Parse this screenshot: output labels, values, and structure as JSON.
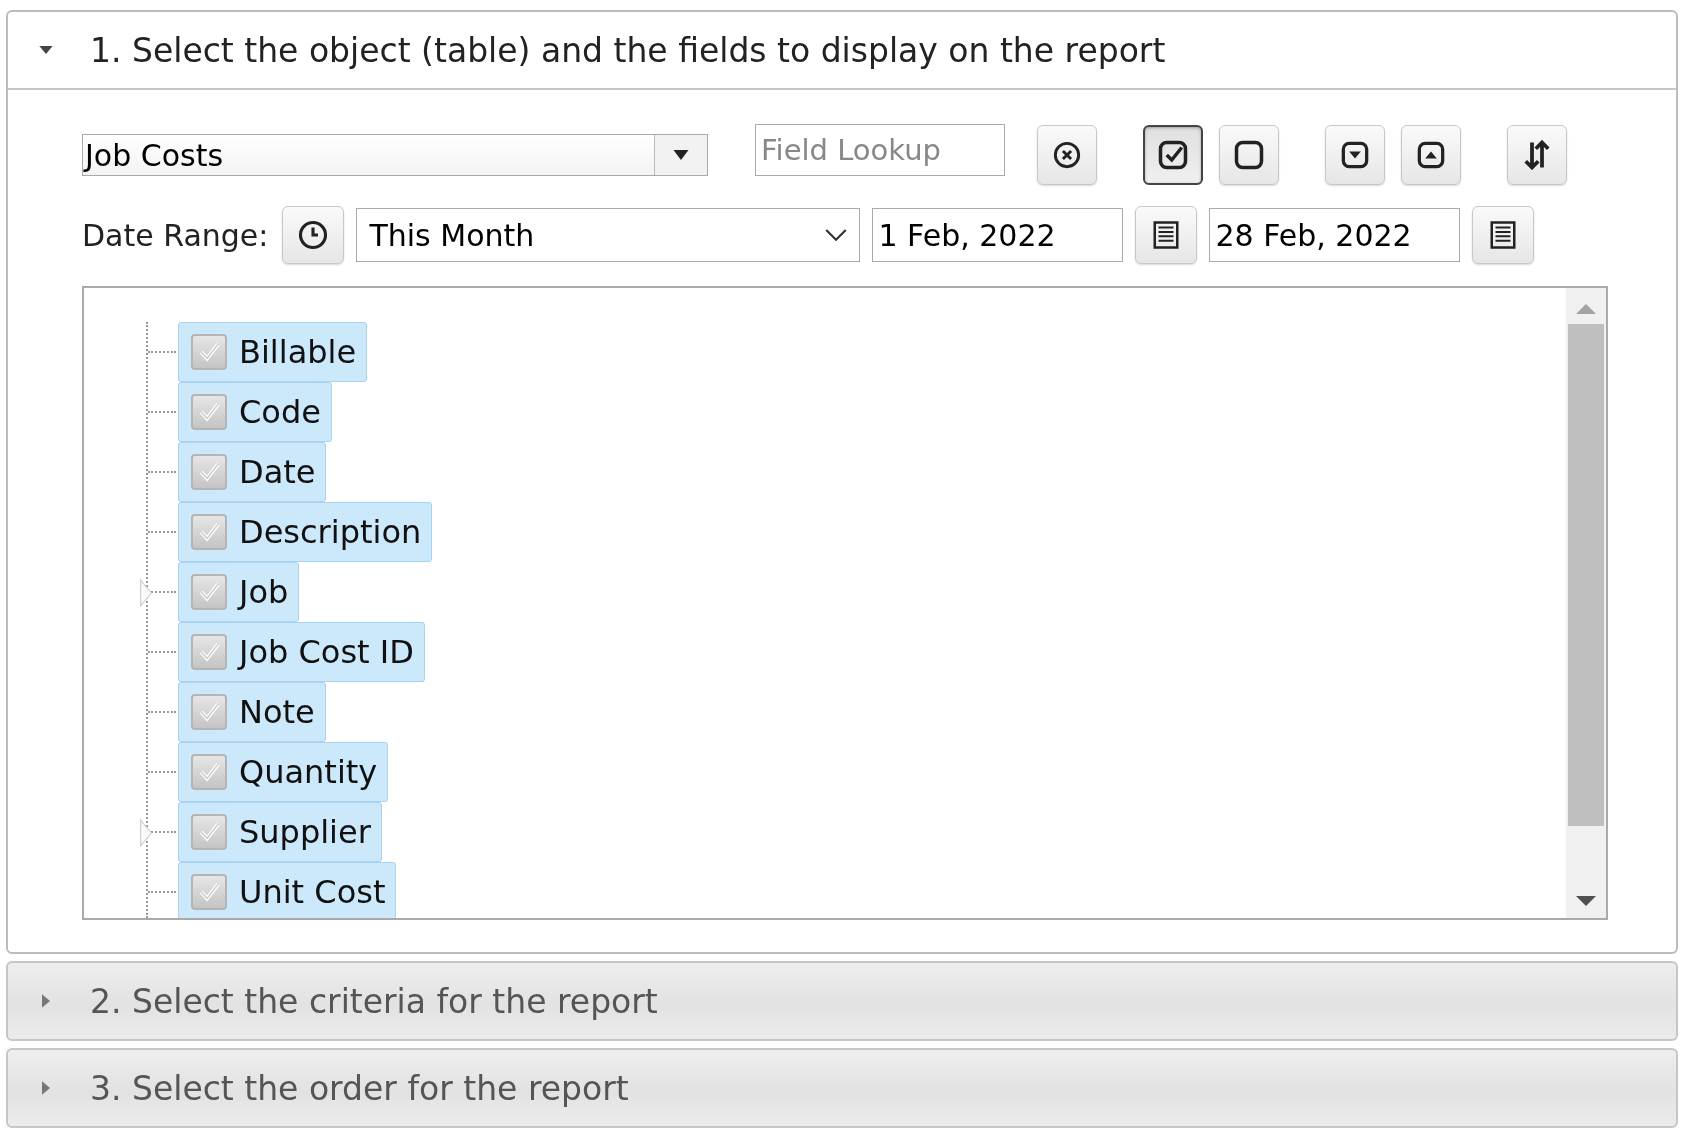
{
  "sections": [
    {
      "title": "1. Select the object (table) and the fields to display on the report",
      "expanded": true
    },
    {
      "title": "2. Select the criteria for the report",
      "expanded": false
    },
    {
      "title": "3. Select the order for the report",
      "expanded": false
    }
  ],
  "object_select": {
    "value": "Job Costs"
  },
  "field_lookup": {
    "placeholder": "Field Lookup"
  },
  "toolbar": [
    {
      "kind": "clear",
      "pressed": false
    },
    {
      "kind": "check-all",
      "pressed": true
    },
    {
      "kind": "uncheck-all",
      "pressed": false
    },
    {
      "kind": "expand",
      "pressed": false
    },
    {
      "kind": "collapse",
      "pressed": false
    },
    {
      "kind": "sort",
      "pressed": false
    }
  ],
  "date_range": {
    "label": "Date Range:",
    "preset": "This Month",
    "from": "1 Feb, 2022",
    "to": "28 Feb, 2022"
  },
  "fields": [
    {
      "label": "Billable",
      "checked": true,
      "expandable": false
    },
    {
      "label": "Code",
      "checked": true,
      "expandable": false
    },
    {
      "label": "Date",
      "checked": true,
      "expandable": false
    },
    {
      "label": "Description",
      "checked": true,
      "expandable": false
    },
    {
      "label": "Job",
      "checked": true,
      "expandable": true
    },
    {
      "label": "Job Cost ID",
      "checked": true,
      "expandable": false
    },
    {
      "label": "Note",
      "checked": true,
      "expandable": false
    },
    {
      "label": "Quantity",
      "checked": true,
      "expandable": false
    },
    {
      "label": "Supplier",
      "checked": true,
      "expandable": true
    },
    {
      "label": "Unit Cost",
      "checked": true,
      "expandable": false
    }
  ]
}
